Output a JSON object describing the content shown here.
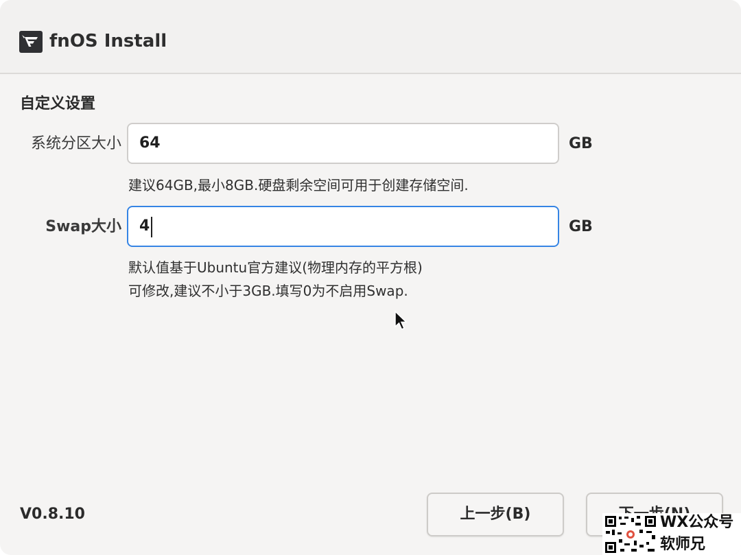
{
  "window": {
    "title": "fnOS Install",
    "logo_icon": "fnos-logo-icon"
  },
  "section": {
    "heading": "自定义设置"
  },
  "system_partition": {
    "label": "系统分区大小",
    "value": "64",
    "unit": "GB",
    "hint": "建议64GB,最小8GB.硬盘剩余空间可用于创建存储空间."
  },
  "swap": {
    "label": "Swap大小",
    "value": "4",
    "unit": "GB",
    "hint_line1": "默认值基于Ubuntu官方建议(物理内存的平方根)",
    "hint_line2": "可修改,建议不小于3GB.填写0为不启用Swap."
  },
  "footer": {
    "version": "V0.8.10",
    "prev_label": "上一步(B)",
    "next_label": "下一步(N)"
  },
  "watermark": {
    "line1": "WX公众号",
    "line2": "软师兄"
  },
  "colors": {
    "accent": "#3584e4",
    "background": "#f5f4f3"
  }
}
